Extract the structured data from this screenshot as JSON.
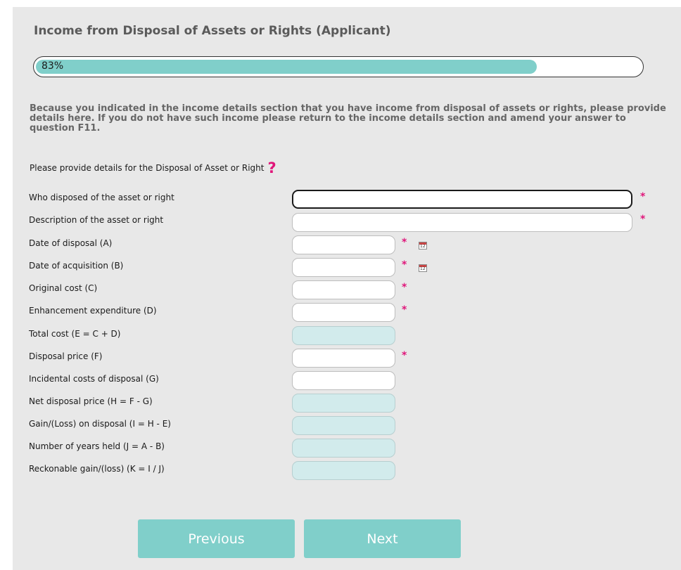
{
  "page": {
    "title": "Income from Disposal of Assets or Rights (Applicant)",
    "progress": {
      "percent": 83,
      "label": "83%"
    },
    "info_text": "Because you indicated in the income details section that you have income from disposal of assets or rights, please provide details here. If you do not have such income please return to the income details section and amend your answer to question F11.",
    "prompt": "Please provide details for the Disposal of Asset or Right",
    "help_symbol": "?",
    "required_mark": "*",
    "colors": {
      "accent": "#80cfca",
      "required": "#e0167a",
      "readonly_field": "#d2ebec"
    }
  },
  "form": {
    "fields": [
      {
        "label": "Who disposed of the asset or right",
        "value": "",
        "required": true,
        "readonly": false
      },
      {
        "label": "Description of the asset or right",
        "value": "",
        "required": true,
        "readonly": false
      },
      {
        "label": "Date of disposal (A)",
        "value": "",
        "required": true,
        "readonly": false,
        "icon": "calendar-icon"
      },
      {
        "label": "Date of acquisition (B)",
        "value": "",
        "required": true,
        "readonly": false,
        "icon": "calendar-icon"
      },
      {
        "label": "Original cost (C)",
        "value": "",
        "required": true,
        "readonly": false
      },
      {
        "label": "Enhancement expenditure (D)",
        "value": "",
        "required": true,
        "readonly": false
      },
      {
        "label": "Total cost (E = C + D)",
        "value": "",
        "required": false,
        "readonly": true
      },
      {
        "label": "Disposal price (F)",
        "value": "",
        "required": true,
        "readonly": false
      },
      {
        "label": "Incidental costs of disposal (G)",
        "value": "",
        "required": false,
        "readonly": false
      },
      {
        "label": "Net disposal price (H = F - G)",
        "value": "",
        "required": false,
        "readonly": true
      },
      {
        "label": "Gain/(Loss) on disposal (I = H - E)",
        "value": "",
        "required": false,
        "readonly": true
      },
      {
        "label": "Number of years held (J = A - B)",
        "value": "",
        "required": false,
        "readonly": true
      },
      {
        "label": "Reckonable gain/(loss) (K = I / J)",
        "value": "",
        "required": false,
        "readonly": true
      }
    ]
  },
  "buttons": {
    "previous": "Previous",
    "next": "Next"
  }
}
